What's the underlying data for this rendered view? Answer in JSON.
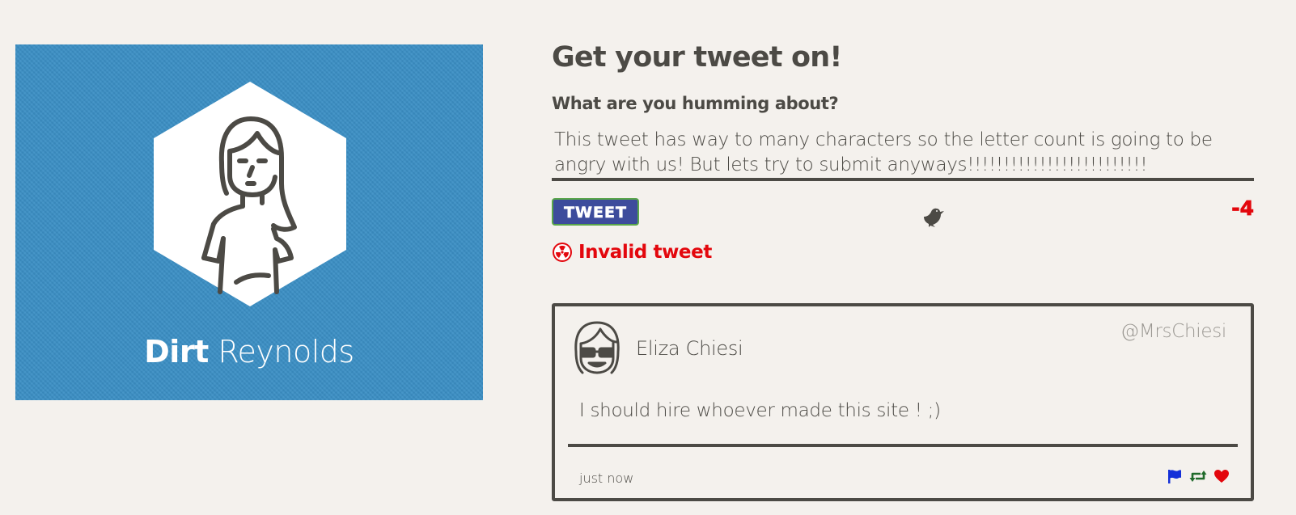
{
  "profile": {
    "first_name": "Dirt",
    "last_name": "Reynolds",
    "card_color": "#3b8fc5"
  },
  "composer": {
    "title": "Get your tweet on!",
    "label": "What are you humming about?",
    "input_value": "This tweet has way to many characters so the letter count is going to be angry with us! But lets try to submit anyways!!!!!!!!!!!!!!!!!!!!!!!!!",
    "tweet_button_label": "TWEET",
    "char_count": "-4",
    "error_message": "Invalid tweet",
    "icons": [
      "bird-icon",
      "radiation-icon"
    ]
  },
  "tweet": {
    "author_name": "Eliza Chiesi",
    "handle": "@MrsChiesi",
    "text": "I should hire whoever made this site ! ;)",
    "timestamp": "just now",
    "actions": [
      "flag-icon",
      "retweet-icon",
      "heart-icon"
    ]
  },
  "colors": {
    "text": "#4c4a45",
    "error": "#e3070d",
    "button": "#3d4c9c",
    "button_border": "#5aa64a",
    "background": "#f4f1ed",
    "flag": "#1430d8",
    "retweet": "#1f6a2a",
    "heart": "#e3070d"
  }
}
